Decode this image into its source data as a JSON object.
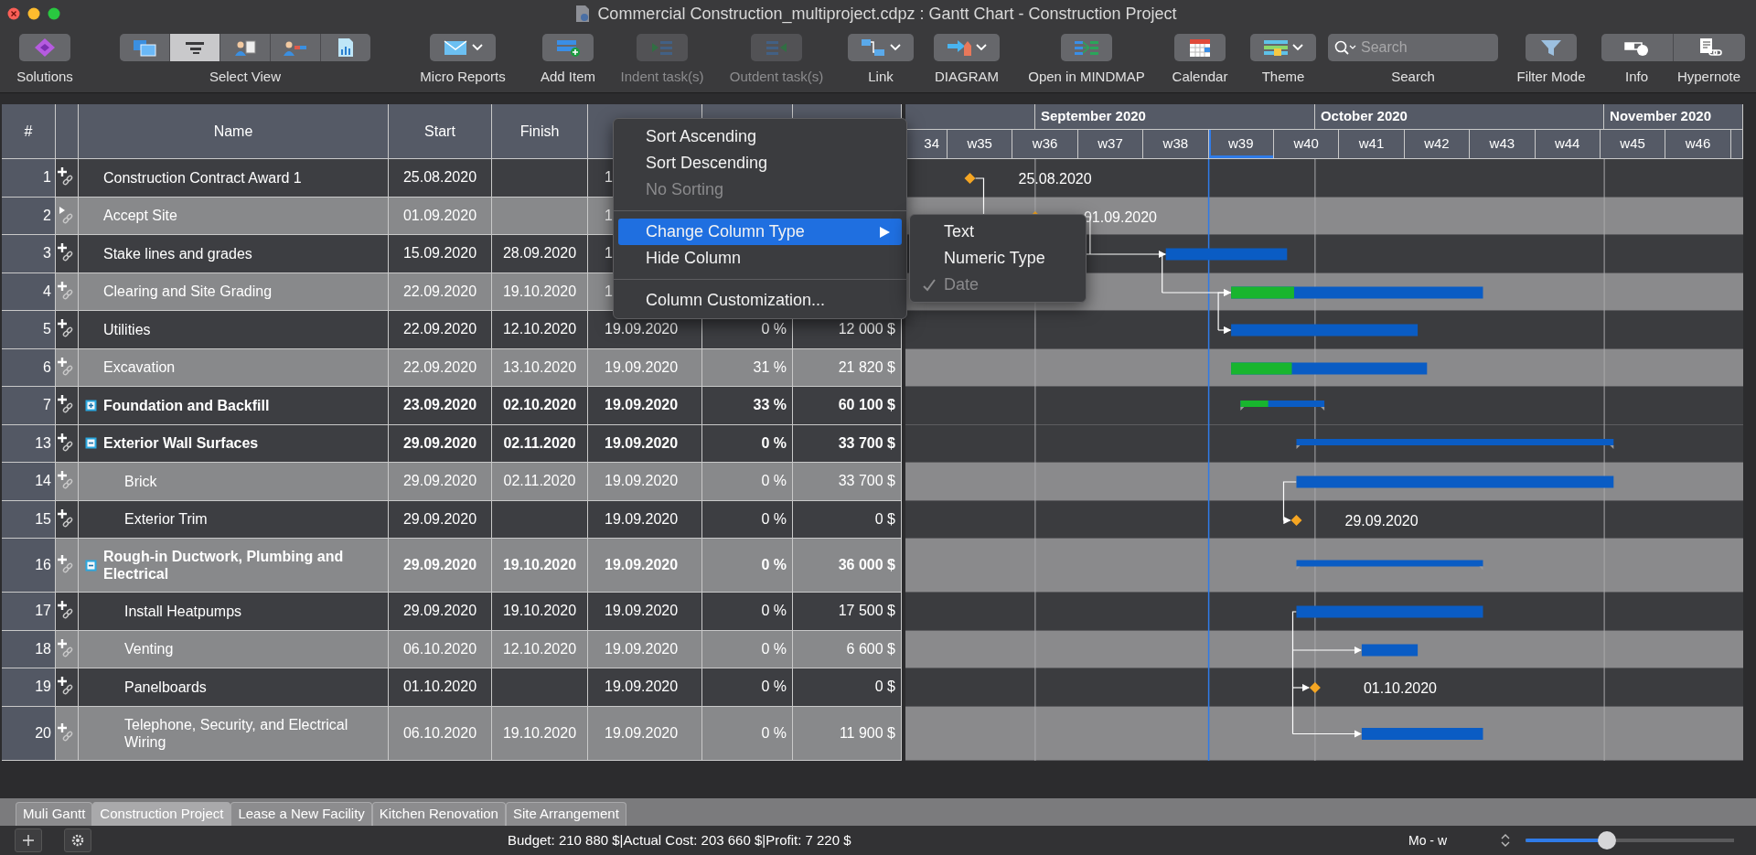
{
  "window": {
    "title": "Commercial Construction_multiproject.cdpz : Gantt Chart - Construction Project"
  },
  "toolbar": [
    {
      "kind": "button",
      "label": "Solutions",
      "disabled": false
    },
    {
      "kind": "segmented",
      "label": "Select View",
      "segments": [
        {
          "selected": false
        },
        {
          "selected": true
        },
        {
          "selected": false
        },
        {
          "selected": false
        },
        {
          "selected": false
        }
      ]
    },
    {
      "kind": "dropdown",
      "label": "Micro Reports",
      "disabled": false
    },
    {
      "kind": "button",
      "label": "Add Item",
      "disabled": false
    },
    {
      "kind": "button",
      "label": "Indent task(s)",
      "disabled": true
    },
    {
      "kind": "button",
      "label": "Outdent task(s)",
      "disabled": true
    },
    {
      "kind": "dropdown",
      "label": "Link",
      "disabled": false
    },
    {
      "kind": "dropdown",
      "label": "DIAGRAM",
      "disabled": false
    },
    {
      "kind": "button",
      "label": "Open in MINDMAP",
      "disabled": false
    },
    {
      "kind": "button",
      "label": "Calendar",
      "disabled": false
    },
    {
      "kind": "dropdown",
      "label": "Theme",
      "disabled": false
    },
    {
      "kind": "search",
      "label": "Search",
      "placeholder": "Search"
    },
    {
      "kind": "button",
      "label": "Filter Mode",
      "disabled": false
    },
    {
      "kind": "pair",
      "segments": [
        {
          "label": "Info"
        },
        {
          "label": "Hypernote"
        }
      ]
    }
  ],
  "table": {
    "columns": [
      "#",
      "Name",
      "Start",
      "Finish"
    ],
    "rows": [
      {
        "num": "1",
        "flagged": false,
        "group": false,
        "shaded": false,
        "name": "Construction Contract Award 1",
        "start": "25.08.2020",
        "column_6": "1",
        "bar": {
          "kind": "milestone",
          "label": "25.08.2020",
          "link_source": true,
          "link_target": false
        }
      },
      {
        "num": "2",
        "flagged": true,
        "group": false,
        "shaded": true,
        "name": "Accept Site",
        "start": "01.09.2020",
        "column_6": "1",
        "bar": {
          "kind": "milestone",
          "label": "01.09.2020",
          "link_source": true,
          "link_target": false
        }
      },
      {
        "num": "3",
        "flagged": false,
        "group": false,
        "shaded": false,
        "name": "Stake lines and grades",
        "start": "15.09.2020",
        "finish": "28.09.2020",
        "column_6": "1",
        "bar": {
          "kind": "task",
          "link_source": true,
          "link_target": true
        }
      },
      {
        "num": "4",
        "flagged": false,
        "group": false,
        "shaded": true,
        "name": "Clearing and Site Grading",
        "start": "22.09.2020",
        "finish": "19.10.2020",
        "column_6": "1",
        "bar": {
          "kind": "task",
          "level": 0.25,
          "link_source": true,
          "link_target": true
        }
      },
      {
        "num": "5",
        "flagged": false,
        "group": false,
        "shaded": false,
        "name": "Utilities",
        "start": "22.09.2020",
        "finish": "12.10.2020",
        "column_6": "19.09.2020",
        "column_7": "0 %",
        "column_8": "12 000 $",
        "bar": {
          "kind": "task",
          "link_source": false,
          "link_target": true
        }
      },
      {
        "num": "6",
        "flagged": false,
        "group": false,
        "shaded": true,
        "name": "Excavation",
        "start": "22.09.2020",
        "finish": "13.10.2020",
        "column_6": "19.09.2020",
        "column_7": "31 %",
        "column_8": "21 820 $",
        "bar": {
          "kind": "task",
          "level": 0.31,
          "link_source": false,
          "link_target": false
        }
      },
      {
        "num": "7",
        "flagged": false,
        "group": true,
        "expanded": false,
        "shaded": false,
        "name": "Foundation and Backfill",
        "start": "23.09.2020",
        "finish": "02.10.2020",
        "column_6": "19.09.2020",
        "column_7": "33 %",
        "column_8": "60 100 $",
        "bar": {
          "kind": "summary",
          "level": 0.33,
          "link_source": false,
          "link_target": false
        }
      },
      {
        "num": "13",
        "flagged": false,
        "group": true,
        "expanded": true,
        "shaded": false,
        "name": "Exterior Wall Surfaces",
        "start": "29.09.2020",
        "finish": "02.11.2020",
        "column_6": "19.09.2020",
        "column_7": "0 %",
        "column_8": "33 700 $",
        "bar": {
          "kind": "summary",
          "link_source": false,
          "link_target": false
        },
        "children": [
          {
            "num": "14",
            "flagged": false,
            "group": false,
            "shaded": true,
            "name": "Brick",
            "start": "29.09.2020",
            "finish": "02.11.2020",
            "column_6": "19.09.2020",
            "column_7": "0 %",
            "column_8": "33 700 $",
            "bar": {
              "kind": "task",
              "link_source": true,
              "link_target": false
            }
          },
          {
            "num": "15",
            "flagged": false,
            "group": false,
            "shaded": false,
            "name": "Exterior Trim",
            "start": "29.09.2020",
            "column_6": "19.09.2020",
            "column_7": "0 %",
            "column_8": "0 $",
            "bar": {
              "kind": "milestone",
              "label": "29.09.2020",
              "link_source": false,
              "link_target": true
            }
          }
        ]
      },
      {
        "num": "16",
        "flagged": false,
        "group": true,
        "expanded": true,
        "shaded": true,
        "name": "Rough-in Ductwork, Plumbing and Electrical",
        "start": "29.09.2020",
        "finish": "19.10.2020",
        "column_6": "19.09.2020",
        "column_7": "0 %",
        "column_8": "36 000 $",
        "bar": {
          "kind": "summary",
          "link_source": false,
          "link_target": false
        },
        "children": [
          {
            "num": "17",
            "flagged": false,
            "group": false,
            "shaded": false,
            "name": "Install Heatpumps",
            "start": "29.09.2020",
            "finish": "19.10.2020",
            "column_6": "19.09.2020",
            "column_7": "0 %",
            "column_8": "17 500 $",
            "bar": {
              "kind": "task",
              "link_source": true,
              "link_target": false
            }
          },
          {
            "num": "18",
            "flagged": false,
            "group": false,
            "shaded": true,
            "name": "Venting",
            "start": "06.10.2020",
            "finish": "12.10.2020",
            "column_6": "19.09.2020",
            "column_7": "0 %",
            "column_8": "6 600 $",
            "bar": {
              "kind": "task",
              "link_source": false,
              "link_target": true
            }
          },
          {
            "num": "19",
            "flagged": false,
            "group": false,
            "shaded": false,
            "name": "Panelboards",
            "start": "01.10.2020",
            "column_6": "19.09.2020",
            "column_7": "0 %",
            "column_8": "0 $",
            "bar": {
              "kind": "milestone",
              "label": "01.10.2020",
              "link_source": false,
              "link_target": true
            }
          },
          {
            "num": "20",
            "flagged": false,
            "group": false,
            "shaded": true,
            "name": "Telephone, Security, and Electrical Wiring",
            "start": "06.10.2020",
            "finish": "19.10.2020",
            "column_6": "19.09.2020",
            "column_7": "0 %",
            "column_8": "11 900 $",
            "bar": {
              "kind": "task",
              "link_source": false,
              "link_target": true
            }
          }
        ]
      }
    ]
  },
  "timeline": {
    "months": [
      {
        "label": "September 2020"
      },
      {
        "label": "October 2020"
      },
      {
        "label": "November 2020"
      }
    ],
    "weeks": [
      {
        "label": "34",
        "current": false
      },
      {
        "label": "w35",
        "current": false
      },
      {
        "label": "w36",
        "current": false
      },
      {
        "label": "w37",
        "current": false
      },
      {
        "label": "w38",
        "current": false
      },
      {
        "label": "w39",
        "current": true
      },
      {
        "label": "w40",
        "current": false
      },
      {
        "label": "w41",
        "current": false
      },
      {
        "label": "w42",
        "current": false
      },
      {
        "label": "w43",
        "current": false
      },
      {
        "label": "w44",
        "current": false
      },
      {
        "label": "w45",
        "current": false
      },
      {
        "label": "w46",
        "current": false
      }
    ]
  },
  "context_menu": {
    "items": [
      {
        "kind": "item",
        "label": "Sort Ascending",
        "disabled": false,
        "selected": false,
        "has_submenu": false
      },
      {
        "kind": "item",
        "label": "Sort Descending",
        "disabled": false,
        "selected": false,
        "has_submenu": false
      },
      {
        "kind": "item",
        "label": "No Sorting",
        "disabled": true,
        "selected": false,
        "has_submenu": false
      },
      {
        "kind": "separator"
      },
      {
        "kind": "item",
        "label": "Change Column Type",
        "disabled": false,
        "selected": true,
        "has_submenu": true
      },
      {
        "kind": "item",
        "label": "Hide Column",
        "disabled": false,
        "selected": false,
        "has_submenu": false
      },
      {
        "kind": "separator"
      },
      {
        "kind": "item",
        "label": "Column Customization...",
        "disabled": false,
        "selected": false,
        "has_submenu": false
      }
    ],
    "submenu": [
      {
        "label": "Text",
        "disabled": false,
        "checked": false
      },
      {
        "label": "Numeric Type",
        "disabled": false,
        "checked": false
      },
      {
        "label": "Date",
        "disabled": true,
        "checked": true
      }
    ]
  },
  "tabs": [
    {
      "label": "Muli Gantt",
      "selected": false
    },
    {
      "label": "Construction Project",
      "selected": true
    },
    {
      "label": "Lease a New Facility",
      "selected": false
    },
    {
      "label": "Kitchen Renovation",
      "selected": false
    },
    {
      "label": "Site Arrangement",
      "selected": false
    }
  ],
  "status_bar": {
    "summary": "Budget: 210 880 $|Actual Cost: 203 660 $|Profit: 7 220 $",
    "scale_label": "Mo - w",
    "zoom": {
      "level": 0.39
    }
  }
}
